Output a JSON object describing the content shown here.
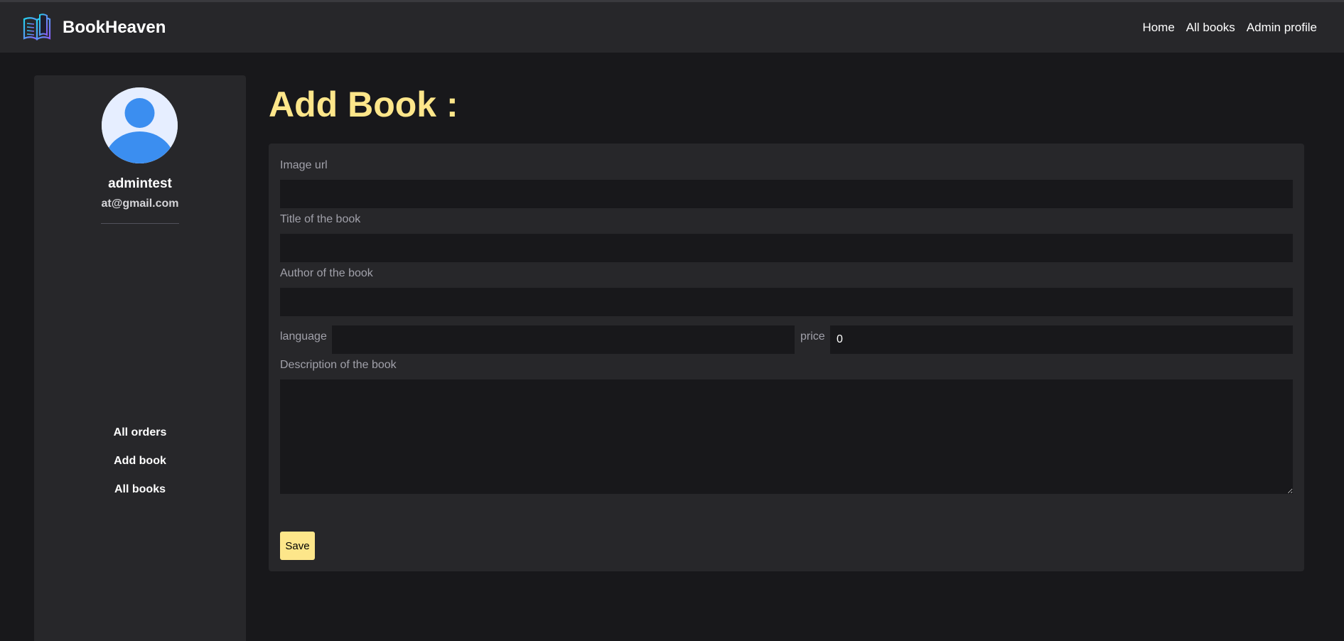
{
  "app": {
    "name": "BookHeaven"
  },
  "nav": {
    "links": [
      "Home",
      "All books",
      "Admin profile"
    ]
  },
  "sidebar": {
    "username": "admintest",
    "email": "at@gmail.com",
    "menu": [
      "All orders",
      "Add book",
      "All books"
    ]
  },
  "page": {
    "title": "Add Book :"
  },
  "form": {
    "image_url_label": "Image url",
    "image_url_value": "",
    "title_label": "Title of the book",
    "title_value": "",
    "author_label": "Author of the book",
    "author_value": "",
    "language_label": "language",
    "language_value": "",
    "price_label": "price",
    "price_value": "0",
    "description_label": "Description of the book",
    "description_value": "",
    "save_label": "Save"
  },
  "colors": {
    "accent": "#fde68a",
    "background": "#18181b",
    "panel": "#27272a",
    "avatar": "#3b8ef0"
  }
}
